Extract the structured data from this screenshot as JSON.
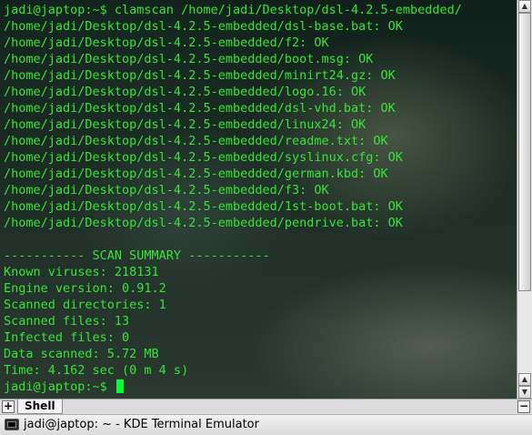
{
  "terminal": {
    "lines": [
      "jadi@japtop:~$ clamscan /home/jadi/Desktop/dsl-4.2.5-embedded/",
      "/home/jadi/Desktop/dsl-4.2.5-embedded/dsl-base.bat: OK",
      "/home/jadi/Desktop/dsl-4.2.5-embedded/f2: OK",
      "/home/jadi/Desktop/dsl-4.2.5-embedded/boot.msg: OK",
      "/home/jadi/Desktop/dsl-4.2.5-embedded/minirt24.gz: OK",
      "/home/jadi/Desktop/dsl-4.2.5-embedded/logo.16: OK",
      "/home/jadi/Desktop/dsl-4.2.5-embedded/dsl-vhd.bat: OK",
      "/home/jadi/Desktop/dsl-4.2.5-embedded/linux24: OK",
      "/home/jadi/Desktop/dsl-4.2.5-embedded/readme.txt: OK",
      "/home/jadi/Desktop/dsl-4.2.5-embedded/syslinux.cfg: OK",
      "/home/jadi/Desktop/dsl-4.2.5-embedded/german.kbd: OK",
      "/home/jadi/Desktop/dsl-4.2.5-embedded/f3: OK",
      "/home/jadi/Desktop/dsl-4.2.5-embedded/1st-boot.bat: OK",
      "/home/jadi/Desktop/dsl-4.2.5-embedded/pendrive.bat: OK",
      "",
      "----------- SCAN SUMMARY -----------",
      "Known viruses: 218131",
      "Engine version: 0.91.2",
      "Scanned directories: 1",
      "Scanned files: 13",
      "Infected files: 0",
      "Data scanned: 5.72 MB",
      "Time: 4.162 sec (0 m 4 s)"
    ],
    "prompt": "jadi@japtop:~$ ",
    "text_color": "#33e633"
  },
  "tabbar": {
    "new_tab_icon": "plus-icon",
    "tab_label": "Shell",
    "close_tab_icon": "minus-icon"
  },
  "taskbar": {
    "icon": "terminal-icon",
    "label": "jadi@japtop: ~ - KDE Terminal Emulator"
  }
}
